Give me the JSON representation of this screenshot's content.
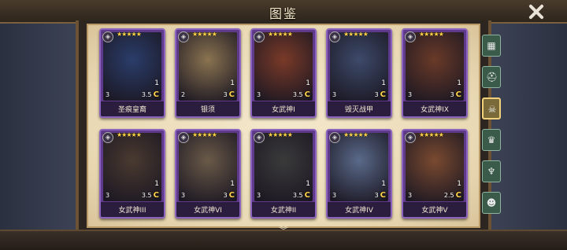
{
  "header": {
    "title": "图鉴"
  },
  "cards_row1": [
    {
      "name": "圣痕皇裔",
      "level": "1",
      "attr": "3",
      "cost": "3.5",
      "stars": "★★★★★",
      "art": "#2a3d6a"
    },
    {
      "name": "银须",
      "level": "1",
      "attr": "2",
      "cost": "3",
      "stars": "★★★★★",
      "art": "#8a7350"
    },
    {
      "name": "女武神I",
      "level": "1",
      "attr": "3",
      "cost": "3.5",
      "stars": "★★★★★",
      "art": "#7a3a28"
    },
    {
      "name": "毁灭战甲",
      "level": "1",
      "attr": "3",
      "cost": "3",
      "stars": "★★★★★",
      "art": "#3d4a6a"
    },
    {
      "name": "女武神IX",
      "level": "1",
      "attr": "3",
      "cost": "3",
      "stars": "★★★★★",
      "art": "#6a3a28"
    }
  ],
  "cards_row2": [
    {
      "name": "女武神III",
      "level": "1",
      "attr": "3",
      "cost": "3.5",
      "stars": "★★★★★",
      "art": "#4a3a30"
    },
    {
      "name": "女武神VI",
      "level": "1",
      "attr": "3",
      "cost": "3",
      "stars": "★★★★★",
      "art": "#6a5a48"
    },
    {
      "name": "女武神II",
      "level": "1",
      "attr": "3",
      "cost": "3.5",
      "stars": "★★★★★",
      "art": "#3a3a3a"
    },
    {
      "name": "女武神IV",
      "level": "1",
      "attr": "3",
      "cost": "3",
      "stars": "★★★★★",
      "art": "#5a6a8a"
    },
    {
      "name": "女武神V",
      "level": "1",
      "attr": "3",
      "cost": "2.5",
      "stars": "★★★★★",
      "art": "#7a4a30"
    }
  ],
  "tabs": [
    {
      "icon": "grid-icon"
    },
    {
      "icon": "helmet-icon"
    },
    {
      "icon": "skull-icon"
    },
    {
      "icon": "crown-icon"
    },
    {
      "icon": "demon-icon"
    },
    {
      "icon": "mask-icon"
    }
  ],
  "ui": {
    "rank_glyph": "◈",
    "cost_glyph": "C",
    "scroll_glyph": "︾"
  }
}
